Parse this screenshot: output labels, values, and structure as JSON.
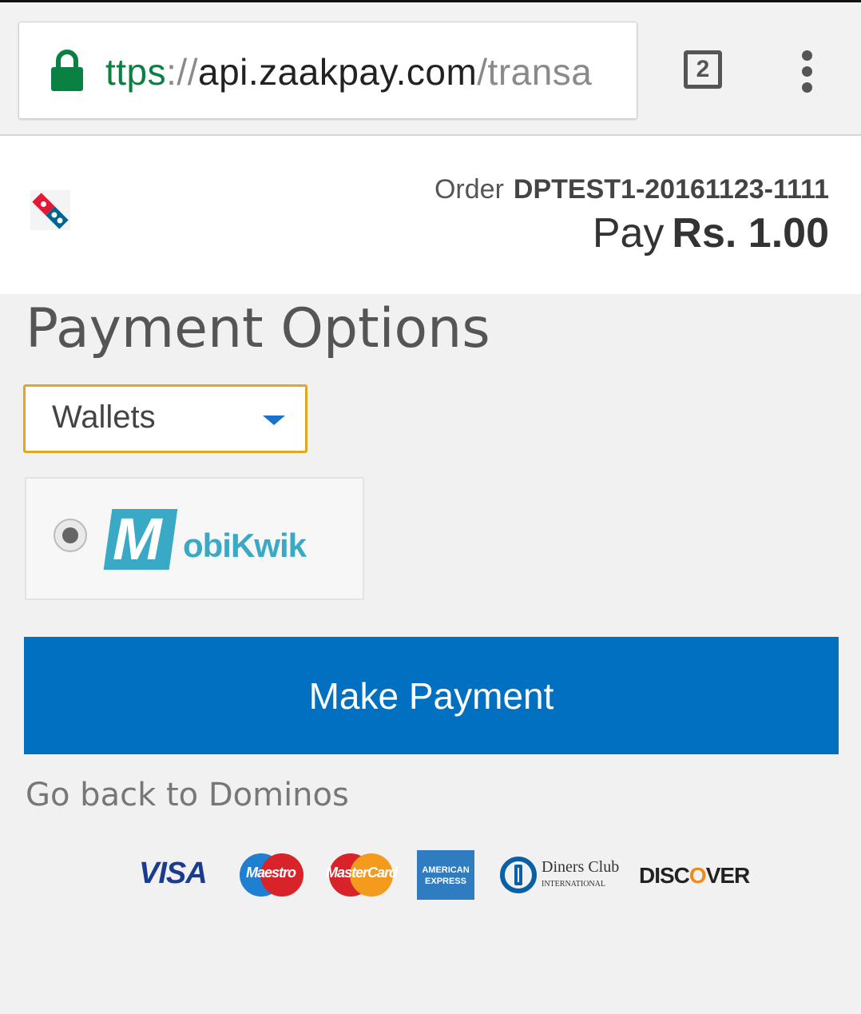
{
  "browser": {
    "url_scheme": "ttps",
    "url_separator": "://",
    "url_host": "api.zaakpay.com",
    "url_path": "/transa",
    "tab_count": "2"
  },
  "header": {
    "order_label": "Order",
    "order_id": "DPTEST1-20161123-1111",
    "pay_label": "Pay",
    "pay_amount": "Rs. 1.00"
  },
  "payment": {
    "title": "Payment Options",
    "method_selected": "Wallets",
    "wallet_option": {
      "brand_mark": "M",
      "brand_text": "obiKwik",
      "selected": true
    },
    "submit_label": "Make Payment",
    "back_link": "Go back to Dominos"
  },
  "card_logos": {
    "visa": "VISA",
    "maestro": "Maestro",
    "mastercard": "MasterCard",
    "amex": "AMERICAN EXPRESS",
    "diners_line1": "Diners Club",
    "diners_line2": "INTERNATIONAL",
    "discover_a": "DISC",
    "discover_o": "O",
    "discover_b": "VER"
  },
  "colors": {
    "accent_blue": "#0170c1",
    "select_border": "#e0a820",
    "secure_green": "#0b8043",
    "mobikwik": "#39a9c6"
  }
}
